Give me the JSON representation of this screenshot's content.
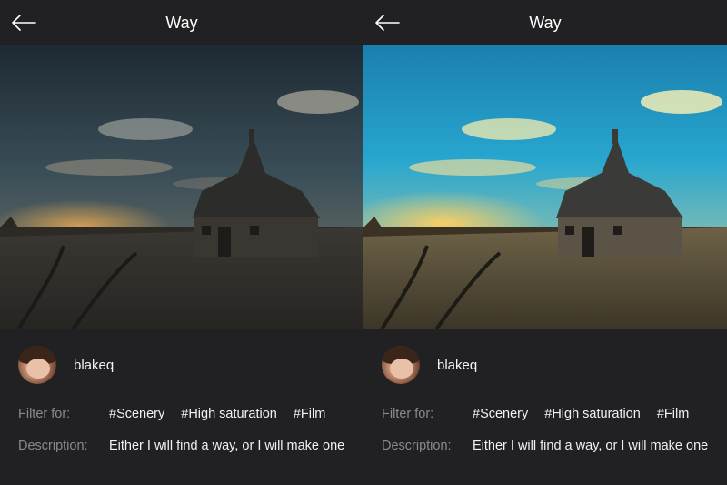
{
  "panels": [
    {
      "header": {
        "title": "Way"
      },
      "user": {
        "name": "blakeq"
      },
      "filter": {
        "label": "Filter for:",
        "tags": [
          "#Scenery",
          "#High saturation",
          "#Film"
        ]
      },
      "description": {
        "label": "Description:",
        "text": "Either I will find a way, or I will make one"
      },
      "image": {
        "variant": "original"
      }
    },
    {
      "header": {
        "title": "Way"
      },
      "user": {
        "name": "blakeq"
      },
      "filter": {
        "label": "Filter for:",
        "tags": [
          "#Scenery",
          "#High saturation",
          "#Film"
        ]
      },
      "description": {
        "label": "Description:",
        "text": "Either I will find a way, or I will make one"
      },
      "image": {
        "variant": "filtered"
      }
    }
  ],
  "icons": {
    "back": "arrow-left-icon"
  },
  "colors": {
    "background": "#212123",
    "label": "#8a8a8c",
    "text": "#f2f2f2"
  }
}
